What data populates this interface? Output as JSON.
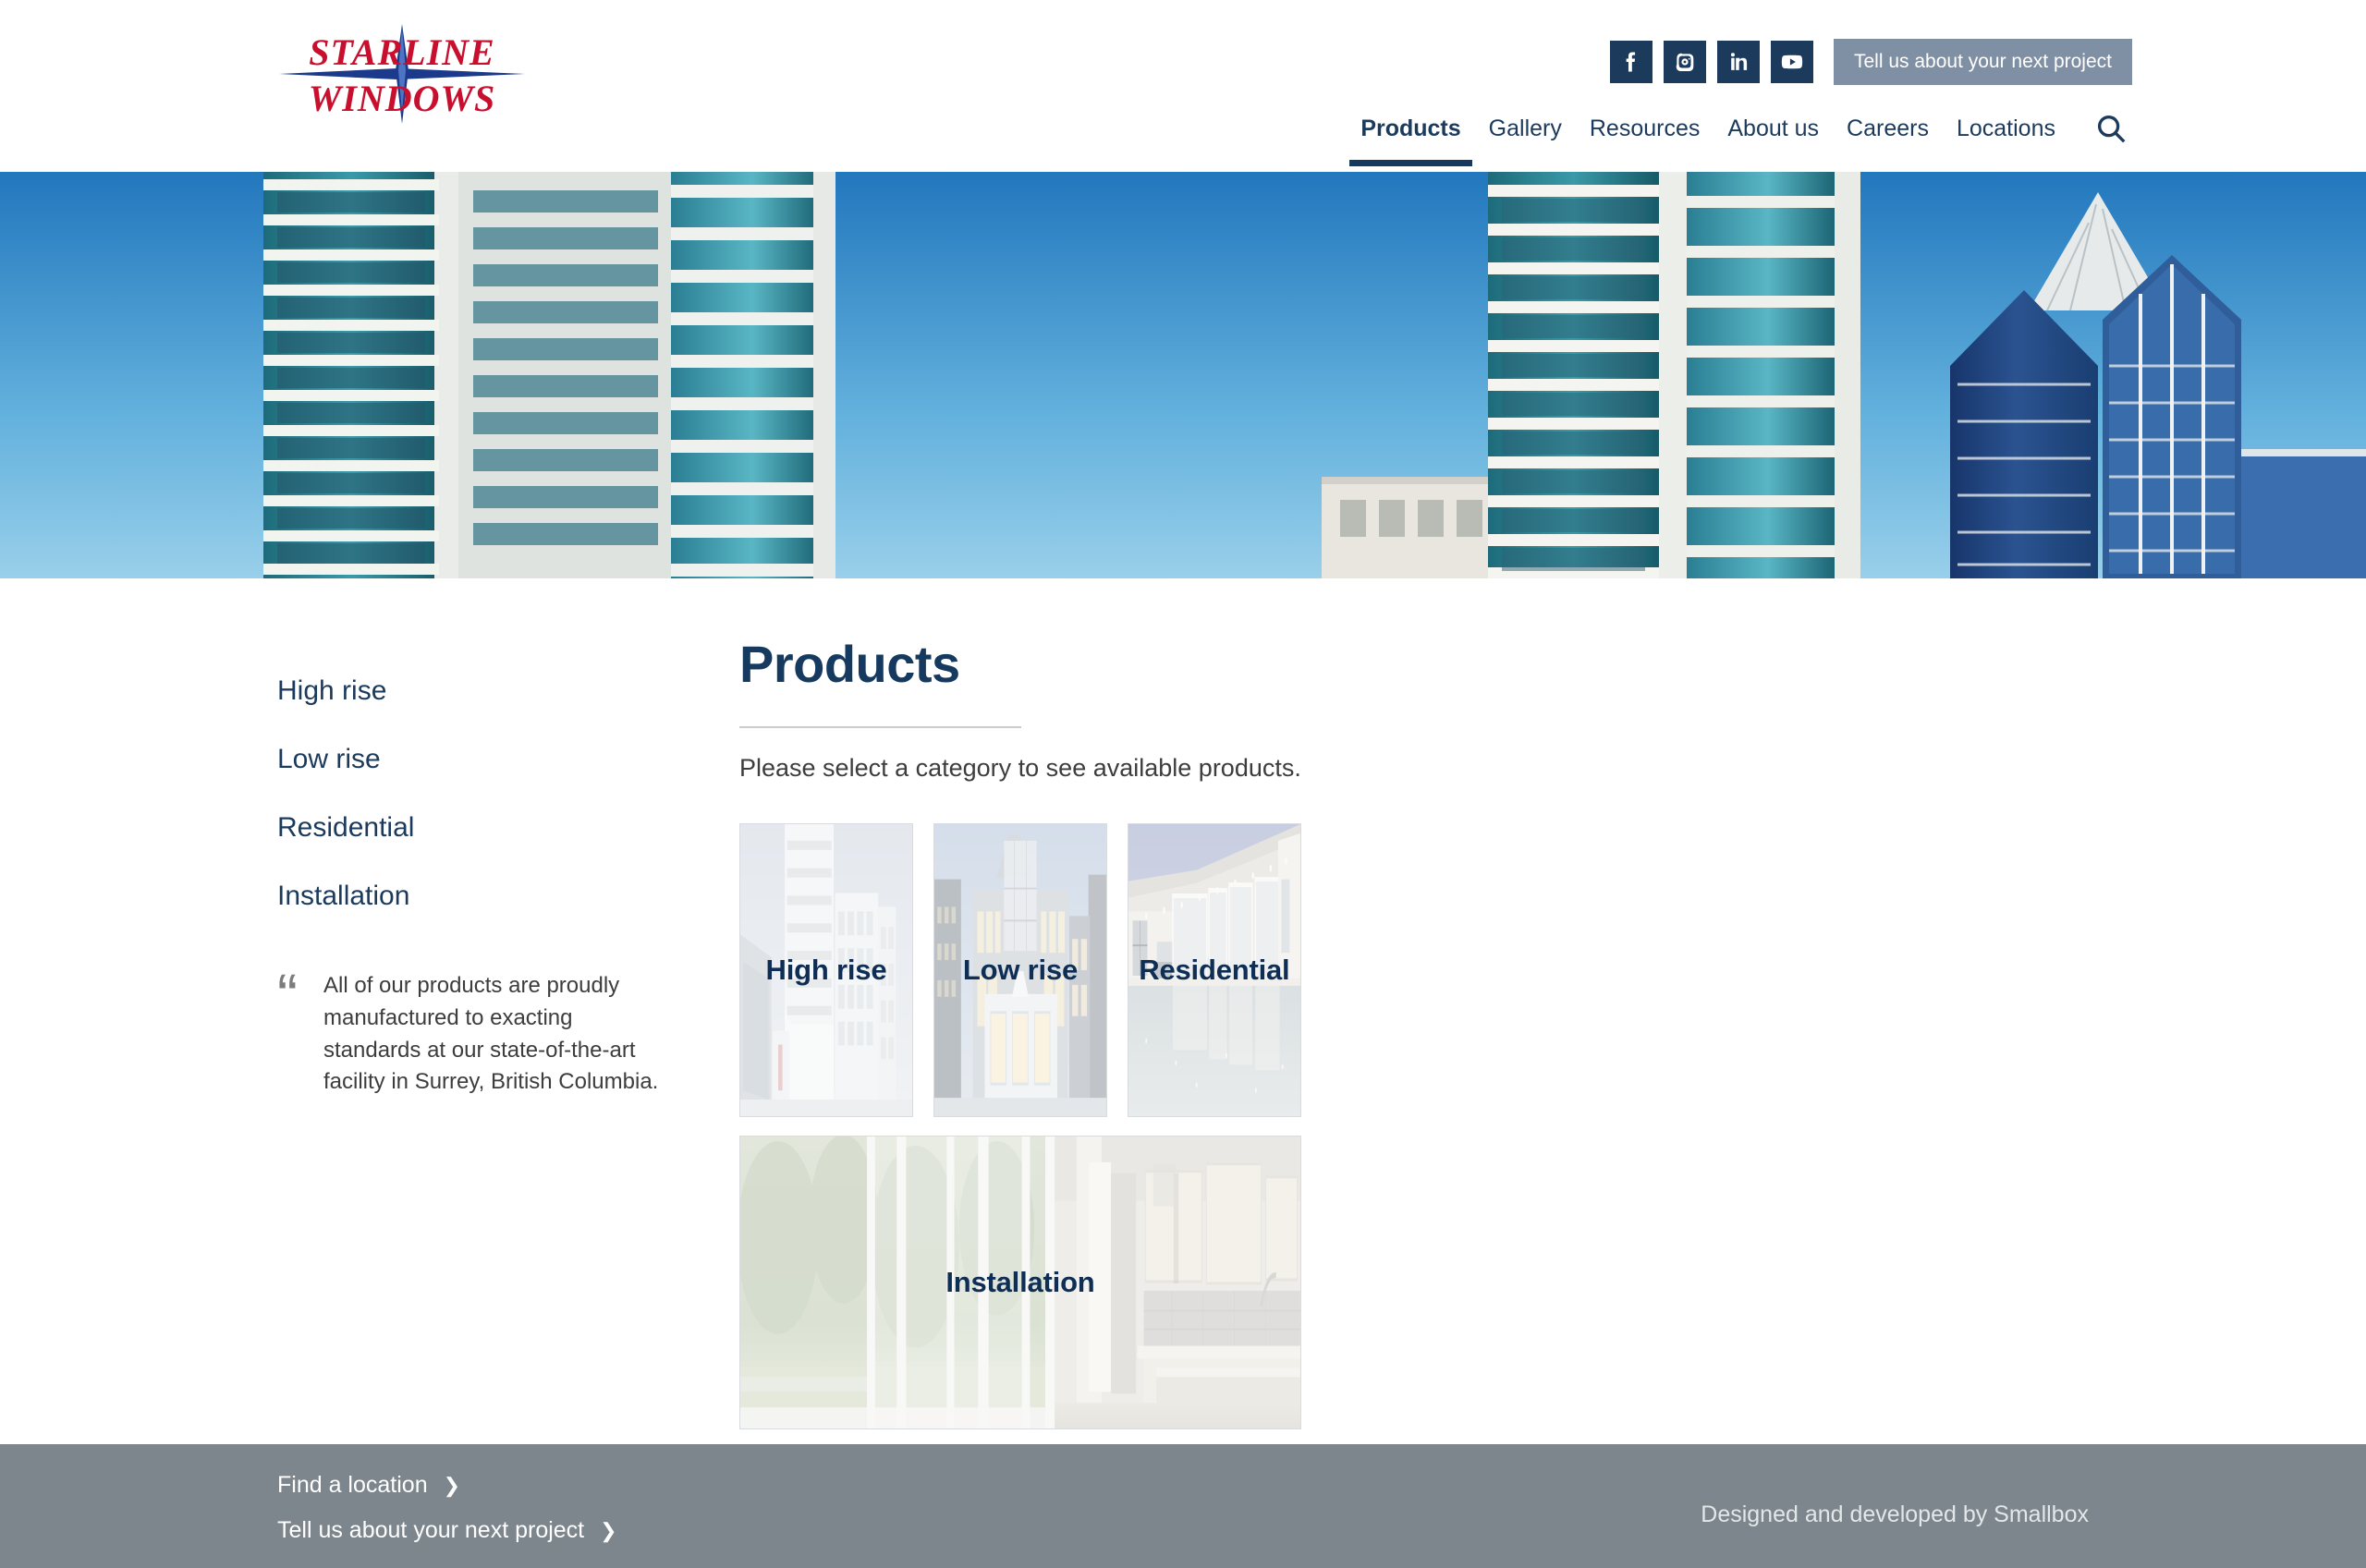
{
  "brand": {
    "logo_line1": "STARLINE",
    "logo_line2": "WINDOWS",
    "logo_color": "#c8102e",
    "logo_star_color": "#1b3a8c",
    "navy": "#1b3a5c",
    "footer_gray": "#7d868c",
    "cta_gray": "#7f8fa4"
  },
  "header": {
    "social": [
      {
        "name": "facebook-icon",
        "label": "Facebook"
      },
      {
        "name": "instagram-icon",
        "label": "Instagram"
      },
      {
        "name": "linkedin-icon",
        "label": "LinkedIn"
      },
      {
        "name": "youtube-icon",
        "label": "YouTube"
      }
    ],
    "cta_label": "Tell us about your next project",
    "nav": [
      {
        "label": "Products",
        "active": true
      },
      {
        "label": "Gallery",
        "active": false
      },
      {
        "label": "Resources",
        "active": false
      },
      {
        "label": "About us",
        "active": false
      },
      {
        "label": "Careers",
        "active": false
      },
      {
        "label": "Locations",
        "active": false
      }
    ],
    "search_icon": "search-icon"
  },
  "hero": {
    "alt": "High rise condominium towers with teal glass balconies against a clear blue sky"
  },
  "sidebar": {
    "items": [
      {
        "label": "High rise"
      },
      {
        "label": "Low rise"
      },
      {
        "label": "Residential"
      },
      {
        "label": "Installation"
      }
    ],
    "quote_mark": "“",
    "quote_text": "All of our products are proudly manufactured to exacting standards at our state-of-the-art facility in Surrey, British Columbia."
  },
  "main": {
    "title": "Products",
    "lead": "Please select a category to see available products.",
    "cards": [
      {
        "label": "High rise",
        "art": "highrise"
      },
      {
        "label": "Low rise",
        "art": "lowrise"
      },
      {
        "label": "Residential",
        "art": "residential"
      },
      {
        "label": "Installation",
        "art": "installation"
      }
    ]
  },
  "footer": {
    "links": [
      {
        "label": "Find a location",
        "chevron": "❯"
      },
      {
        "label": "Tell us about your next project",
        "chevron": "❯"
      }
    ],
    "credit": "Designed and developed by Smallbox"
  }
}
